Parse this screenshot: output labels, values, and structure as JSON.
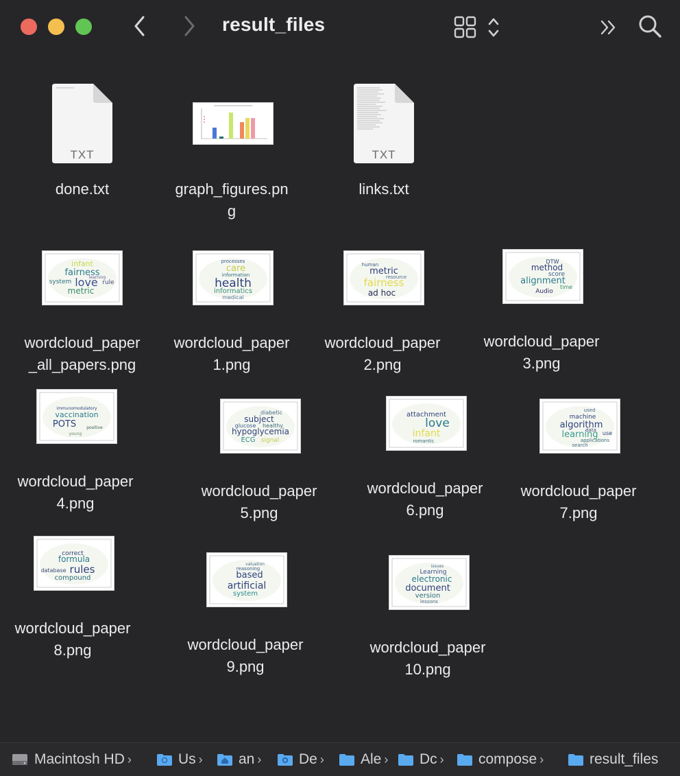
{
  "window": {
    "title": "result_files"
  },
  "files": {
    "done": {
      "label": "done.txt",
      "badge": "TXT"
    },
    "graph": {
      "label": "graph_figures.pn\ng"
    },
    "links": {
      "label": "links.txt",
      "badge": "TXT"
    },
    "wc_all": {
      "label": "wordcloud_paper\n_all_papers.png",
      "words": [
        "infant",
        "fairness",
        "love",
        "rule",
        "system",
        "metric",
        "learning"
      ]
    },
    "wc1": {
      "label": "wordcloud_paper\n1.png",
      "words": [
        "processes",
        "care",
        "information",
        "health",
        "informatics",
        "medical"
      ]
    },
    "wc2": {
      "label": "wordcloud_paper\n2.png",
      "words": [
        "human",
        "metric",
        "resource",
        "fairness",
        "ad hoc"
      ]
    },
    "wc3": {
      "label": "wordcloud_paper\n3.png",
      "words": [
        "DTW",
        "method",
        "score",
        "alignment",
        "time",
        "Audio"
      ]
    },
    "wc4": {
      "label": "wordcloud_paper\n4.png",
      "words": [
        "immunomodulatory",
        "vaccination",
        "POTS",
        "positive",
        "young"
      ]
    },
    "wc5": {
      "label": "wordcloud_paper\n5.png",
      "words": [
        "diabetic",
        "subject",
        "healthy",
        "glucose",
        "hypoglycemia",
        "ECG",
        "signal"
      ]
    },
    "wc6": {
      "label": "wordcloud_paper\n6.png",
      "words": [
        "attachment",
        "love",
        "infant",
        "romantic"
      ]
    },
    "wc7": {
      "label": "wordcloud_paper\n7.png",
      "words": [
        "used",
        "machine",
        "algorithm",
        "learning",
        "data",
        "use",
        "applications",
        "search"
      ]
    },
    "wc8": {
      "label": "wordcloud_paper\n8.png",
      "words": [
        "correct",
        "formula",
        "rules",
        "database",
        "compound"
      ]
    },
    "wc9": {
      "label": "wordcloud_paper\n9.png",
      "words": [
        "valuation",
        "reasoning",
        "based",
        "artificial",
        "system"
      ]
    },
    "wc10": {
      "label": "wordcloud_paper\n10.png",
      "words": [
        "issues",
        "Learning",
        "electronic",
        "document",
        "version",
        "lessons"
      ]
    }
  },
  "pathbar": {
    "items": [
      {
        "label": "Macintosh HD",
        "icon": "hard-drive-icon"
      },
      {
        "label": "Us",
        "icon": "user-folder-icon"
      },
      {
        "label": "an",
        "icon": "home-folder-icon"
      },
      {
        "label": "De",
        "icon": "desktop-folder-icon"
      },
      {
        "label": "Ale",
        "icon": "folder-icon"
      },
      {
        "label": "Dc",
        "icon": "folder-icon"
      },
      {
        "label": "compose",
        "icon": "folder-icon"
      },
      {
        "label": "result_files",
        "icon": "folder-icon"
      }
    ],
    "separator": "›"
  },
  "icons": {
    "back": "chevron-left-icon",
    "forward": "chevron-right-icon",
    "view": "grid-view-icon",
    "more": "double-chevron-icon",
    "search": "search-icon"
  },
  "colors": {
    "background": "#262629",
    "folder_blue": "#5aaaf0",
    "close": "#ed6a5e",
    "minimize": "#f5bf4f",
    "zoom": "#61c554"
  }
}
